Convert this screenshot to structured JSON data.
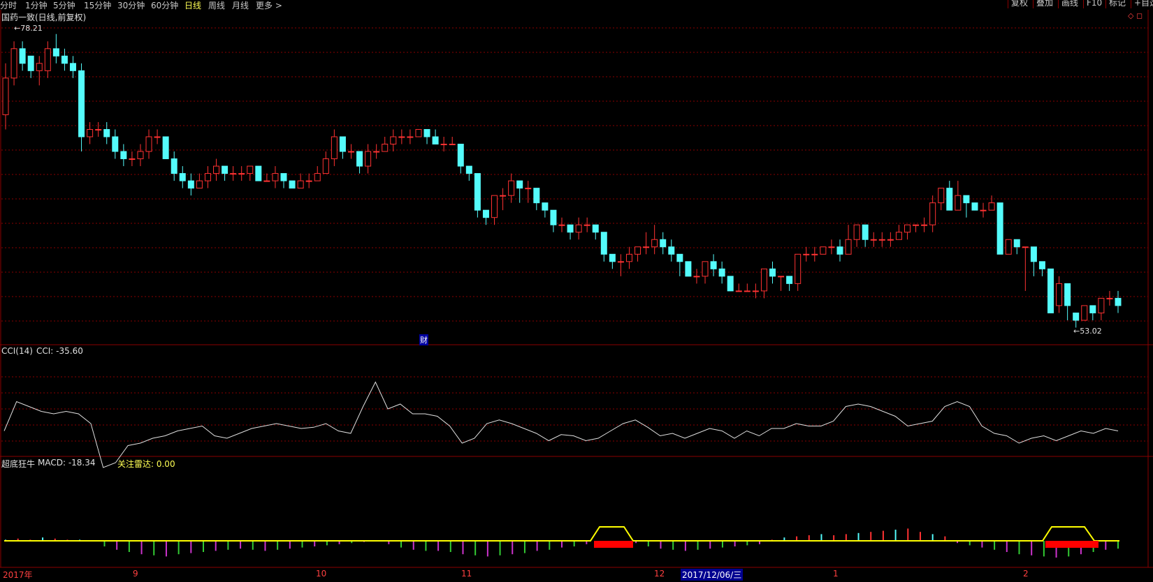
{
  "topbar": {
    "periods": [
      "分时",
      "1分钟",
      "5分钟",
      "15分钟",
      "30分钟",
      "60分钟",
      "日线",
      "周线",
      "月线",
      "更多 >"
    ],
    "active_period": "日线",
    "right_buttons": [
      "复权",
      "叠加",
      "画线",
      "F10",
      "标记",
      "+自选"
    ]
  },
  "main": {
    "title": "国药一致(日线,前复权)",
    "high_label": "78.21",
    "low_label": "53.02",
    "finance_marker": "财"
  },
  "cci": {
    "label": "CCI(14)",
    "value_label": "CCI: -35.60"
  },
  "macd": {
    "label": "超底狂牛",
    "macd_label": "MACD: -18.34",
    "radar_label": "关注雷达: 0.00"
  },
  "xaxis": {
    "labels": [
      "2017年",
      "9",
      "10",
      "11",
      "12",
      "1",
      "2"
    ],
    "cursor_date": "2017/12/06/三"
  },
  "colors": {
    "up": "#ff3232",
    "down": "#54fcfc",
    "grid": "#8b0000",
    "cci_line": "#e0e0e0",
    "signal": "#ffff00",
    "bar_red": "#ff0000",
    "hist_green": "#33cc33",
    "hist_magenta": "#cc33cc"
  },
  "chart_data": {
    "type": "candlestick",
    "ohlc": [
      [
        66,
        71,
        73,
        64
      ],
      [
        71,
        75,
        76,
        70
      ],
      [
        75,
        73,
        76,
        72
      ],
      [
        74,
        72,
        74,
        71
      ],
      [
        72,
        73,
        74,
        70
      ],
      [
        72,
        75,
        76,
        71
      ],
      [
        75,
        74,
        77,
        73
      ],
      [
        74,
        73,
        75,
        72
      ],
      [
        73,
        72,
        74,
        71
      ],
      [
        72,
        63,
        73,
        61
      ],
      [
        63,
        64,
        65,
        62
      ],
      [
        64,
        64,
        65,
        63
      ],
      [
        64,
        63,
        65,
        62
      ],
      [
        63,
        61,
        64,
        60
      ],
      [
        61,
        60,
        62,
        59
      ],
      [
        60,
        60,
        61,
        59
      ],
      [
        60,
        61,
        62,
        59
      ],
      [
        61,
        63,
        64,
        60
      ],
      [
        63,
        63,
        64,
        62
      ],
      [
        63,
        60,
        63,
        60
      ],
      [
        60,
        58,
        61,
        57
      ],
      [
        58,
        57,
        59,
        56
      ],
      [
        57,
        56,
        58,
        55
      ],
      [
        56,
        57,
        58,
        56
      ],
      [
        57,
        58,
        59,
        56
      ],
      [
        58,
        59,
        60,
        57
      ],
      [
        59,
        58,
        59,
        57
      ],
      [
        58,
        58,
        59,
        57
      ],
      [
        58,
        58,
        59,
        57
      ],
      [
        58,
        59,
        59,
        57
      ],
      [
        59,
        57,
        59,
        57
      ],
      [
        57,
        57,
        58,
        57
      ],
      [
        57,
        58,
        59,
        56
      ],
      [
        58,
        57,
        58,
        56
      ],
      [
        57,
        56,
        57,
        56
      ],
      [
        56,
        57,
        58,
        56
      ],
      [
        57,
        57,
        58,
        56
      ],
      [
        57,
        58,
        59,
        57
      ],
      [
        58,
        60,
        61,
        58
      ],
      [
        60,
        63,
        64,
        59
      ],
      [
        63,
        61,
        63,
        60
      ],
      [
        61,
        61,
        62,
        60
      ],
      [
        61,
        59,
        61,
        58
      ],
      [
        59,
        61,
        62,
        58
      ],
      [
        61,
        61,
        62,
        60
      ],
      [
        61,
        62,
        63,
        61
      ],
      [
        62,
        63,
        64,
        61
      ],
      [
        63,
        63,
        64,
        62
      ],
      [
        63,
        63,
        64,
        62
      ],
      [
        63,
        64,
        64,
        63
      ],
      [
        64,
        63,
        64,
        62
      ],
      [
        63,
        62,
        64,
        62
      ],
      [
        62,
        62,
        63,
        61
      ],
      [
        62,
        62,
        63,
        62
      ],
      [
        62,
        59,
        62,
        58
      ],
      [
        59,
        58,
        59,
        57
      ],
      [
        58,
        53,
        58,
        52
      ],
      [
        53,
        52,
        53,
        51
      ],
      [
        52,
        55,
        55,
        51
      ],
      [
        55,
        55,
        56,
        53
      ],
      [
        55,
        57,
        58,
        54
      ],
      [
        57,
        56,
        57,
        54
      ],
      [
        56,
        56,
        57,
        54
      ],
      [
        56,
        54,
        56,
        53
      ],
      [
        54,
        53,
        54,
        52
      ],
      [
        53,
        51,
        53,
        50
      ],
      [
        51,
        51,
        52,
        50
      ],
      [
        51,
        50,
        51,
        49
      ],
      [
        50,
        51,
        52,
        49
      ],
      [
        51,
        51,
        52,
        50
      ],
      [
        51,
        50,
        51,
        49
      ],
      [
        50,
        47,
        50,
        46
      ],
      [
        47,
        46,
        47,
        45
      ],
      [
        46,
        46,
        47,
        44
      ],
      [
        46,
        47,
        48,
        45
      ],
      [
        47,
        48,
        48,
        46
      ],
      [
        48,
        48,
        50,
        47
      ],
      [
        48,
        49,
        51,
        47
      ],
      [
        49,
        48,
        50,
        47
      ],
      [
        48,
        47,
        49,
        46
      ],
      [
        47,
        46,
        47,
        44
      ],
      [
        46,
        44,
        46,
        44
      ],
      [
        44,
        44,
        45,
        43
      ],
      [
        44,
        46,
        46,
        43
      ],
      [
        46,
        45,
        47,
        44
      ],
      [
        45,
        44,
        46,
        43
      ],
      [
        44,
        42,
        44,
        42
      ],
      [
        42,
        42,
        43,
        42
      ],
      [
        42,
        42,
        43,
        42
      ],
      [
        42,
        42,
        43,
        41
      ],
      [
        42,
        45,
        45,
        41
      ],
      [
        45,
        44,
        46,
        43
      ],
      [
        44,
        44,
        44,
        42
      ],
      [
        44,
        43,
        44,
        42
      ],
      [
        43,
        47,
        47,
        42
      ],
      [
        47,
        47,
        48,
        46
      ],
      [
        47,
        47,
        48,
        46
      ],
      [
        47,
        48,
        48,
        47
      ],
      [
        48,
        48,
        49,
        47
      ],
      [
        48,
        47,
        49,
        46
      ],
      [
        47,
        49,
        51,
        47
      ],
      [
        49,
        51,
        51,
        48
      ],
      [
        51,
        49,
        51,
        48
      ],
      [
        49,
        49,
        50,
        48
      ],
      [
        49,
        49,
        50,
        48
      ],
      [
        49,
        49,
        50,
        48
      ],
      [
        49,
        50,
        51,
        49
      ],
      [
        50,
        51,
        51,
        49
      ],
      [
        51,
        51,
        51,
        50
      ],
      [
        51,
        51,
        52,
        50
      ],
      [
        51,
        54,
        55,
        50
      ],
      [
        54,
        56,
        56,
        53
      ],
      [
        56,
        53,
        57,
        53
      ],
      [
        53,
        55,
        57,
        53
      ],
      [
        55,
        54,
        55,
        52
      ],
      [
        54,
        53,
        54,
        53
      ],
      [
        53,
        53,
        54,
        52
      ],
      [
        53,
        54,
        55,
        53
      ],
      [
        54,
        47,
        54,
        47
      ],
      [
        47,
        49,
        49,
        47
      ],
      [
        49,
        48,
        49,
        47
      ],
      [
        48,
        48,
        48,
        42
      ],
      [
        48,
        46,
        47,
        44
      ],
      [
        46,
        45,
        46,
        44
      ],
      [
        45,
        39,
        44,
        39
      ],
      [
        40,
        43,
        44,
        39
      ],
      [
        43,
        40,
        43,
        38
      ],
      [
        39,
        38,
        39,
        37
      ],
      [
        38,
        40,
        40,
        38
      ],
      [
        40,
        39,
        40,
        38
      ],
      [
        39,
        41,
        41,
        38
      ],
      [
        41,
        41,
        42,
        40
      ],
      [
        41,
        40,
        42,
        39
      ]
    ],
    "cci": [
      -90,
      30,
      10,
      -10,
      -20,
      -10,
      -20,
      -60,
      -240,
      -220,
      -150,
      -140,
      -120,
      -110,
      -90,
      -80,
      -70,
      -110,
      -120,
      -100,
      -80,
      -70,
      -60,
      -70,
      -80,
      -75,
      -60,
      -90,
      -100,
      10,
      110,
      0,
      20,
      -20,
      -20,
      -30,
      -70,
      -140,
      -120,
      -60,
      -45,
      -60,
      -80,
      -100,
      -130,
      -105,
      -110,
      -130,
      -120,
      -90,
      -60,
      -45,
      -75,
      -110,
      -100,
      -120,
      -100,
      -80,
      -90,
      -120,
      -90,
      -110,
      -80,
      -80,
      -60,
      -70,
      -70,
      -50,
      10,
      20,
      10,
      -10,
      -30,
      -70,
      -60,
      -50,
      10,
      30,
      10,
      -70,
      -100,
      -110,
      -140,
      -120,
      -110,
      -130,
      -110,
      -90,
      -100,
      -80,
      -90
    ],
    "macd_hist": [
      1,
      2,
      1,
      3,
      2,
      1,
      1,
      0,
      -5,
      -8,
      -10,
      -12,
      -13,
      -14,
      -12,
      -11,
      -10,
      -9,
      -8,
      -7,
      -8,
      -9,
      -8,
      -7,
      -6,
      -5,
      -4,
      -3,
      -2,
      -1,
      0,
      -3,
      -6,
      -8,
      -9,
      -9,
      -10,
      -12,
      -13,
      -14,
      -13,
      -12,
      -11,
      -9,
      -8,
      -6,
      -5,
      -3,
      -2,
      -1,
      0,
      -2,
      -5,
      -7,
      -8,
      -9,
      -8,
      -7,
      -6,
      -5,
      -4,
      -3,
      1,
      3,
      4,
      5,
      6,
      5,
      6,
      7,
      8,
      9,
      10,
      11,
      8,
      6,
      4,
      -2,
      -4,
      -6,
      -8,
      -10,
      -12,
      -13,
      -14,
      -15,
      -14,
      -12,
      -10,
      -8,
      -7
    ]
  }
}
